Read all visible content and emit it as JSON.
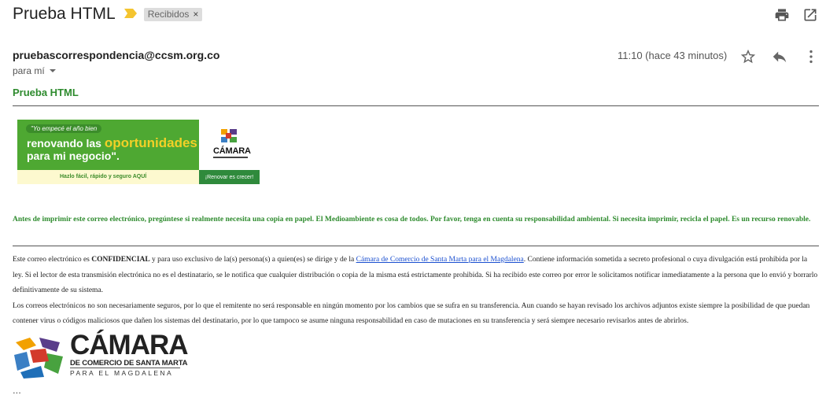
{
  "email": {
    "subject": "Prueba HTML",
    "label_chip": "Recibidos",
    "label_remove": "×",
    "sender": "pruebascorrespondencia@ccsm.org.co",
    "to": "para mí",
    "time": "11:10 (hace 43 minutos)",
    "body_title": "Prueba HTML"
  },
  "banner": {
    "quote": "\"Yo empecé el año bien",
    "line1_a": "renovando las ",
    "line1_b": "oportunidades",
    "line2": "para mi negocio\".",
    "cta": "Hazlo fácil, rápido y seguro AQUÍ",
    "logo_word": "CÁMARA",
    "button": "¡Renovar es crecer!"
  },
  "notices": {
    "environment": "Antes de imprimir este correo electrónico, pregúntese si realmente necesita una copia en papel. El Medioambiente es cosa de todos. Por favor, tenga en cuenta su responsabilidad ambiental. Si necesita imprimir, recicla el papel. Es un recurso renovable.",
    "conf_a": "Este correo electrónico es ",
    "conf_b": "CONFIDENCIAL",
    "conf_c": " y para uso exclusivo de la(s) persona(s) a quien(es) se dirige y de la ",
    "conf_link": "Cámara de Comercio de Santa Marta para el Magdalena",
    "conf_d": ". Contiene información sometida a secreto profesional o cuya divulgación está prohibida por la ley.  Si el lector de esta transmisión electrónica no es el destinatario, se le notifica que cualquier distribución o copia de la misma está estrictamente prohibida. Si ha recibido este correo por error le solicitamos notificar inmediatamente a la persona que lo envió y borrarlo definitivamente de su sistema.",
    "security": "Los correos electrónicos no son necesariamente seguros, por lo que el remitente no será responsable en ningún momento por los cambios que se sufra en su transferencia. Aun cuando se hayan revisado los archivos adjuntos existe siempre la posibilidad de que puedan contener virus o códigos maliciosos que dañen los sistemas del destinatario, por lo que tampoco se asume ninguna responsabilidad en caso de mutaciones en su transferencia y será siempre necesario revisarlos antes de abrirlos."
  },
  "signature": {
    "word": "CÁMARA",
    "line1": "DE COMERCIO DE SANTA MARTA",
    "line2": "PARA EL MAGDALENA"
  },
  "ellipsis": "...",
  "icons": {
    "importance": "importance-marker-icon",
    "print": "print-icon",
    "new_window": "open-in-new-window-icon",
    "star": "star-icon",
    "reply": "reply-icon",
    "more": "more-vertical-icon"
  },
  "colors": {
    "green_text": "#2e8b2e",
    "banner_green": "#4ea832",
    "link": "#1a4fd0",
    "importance": "#f4c430"
  }
}
